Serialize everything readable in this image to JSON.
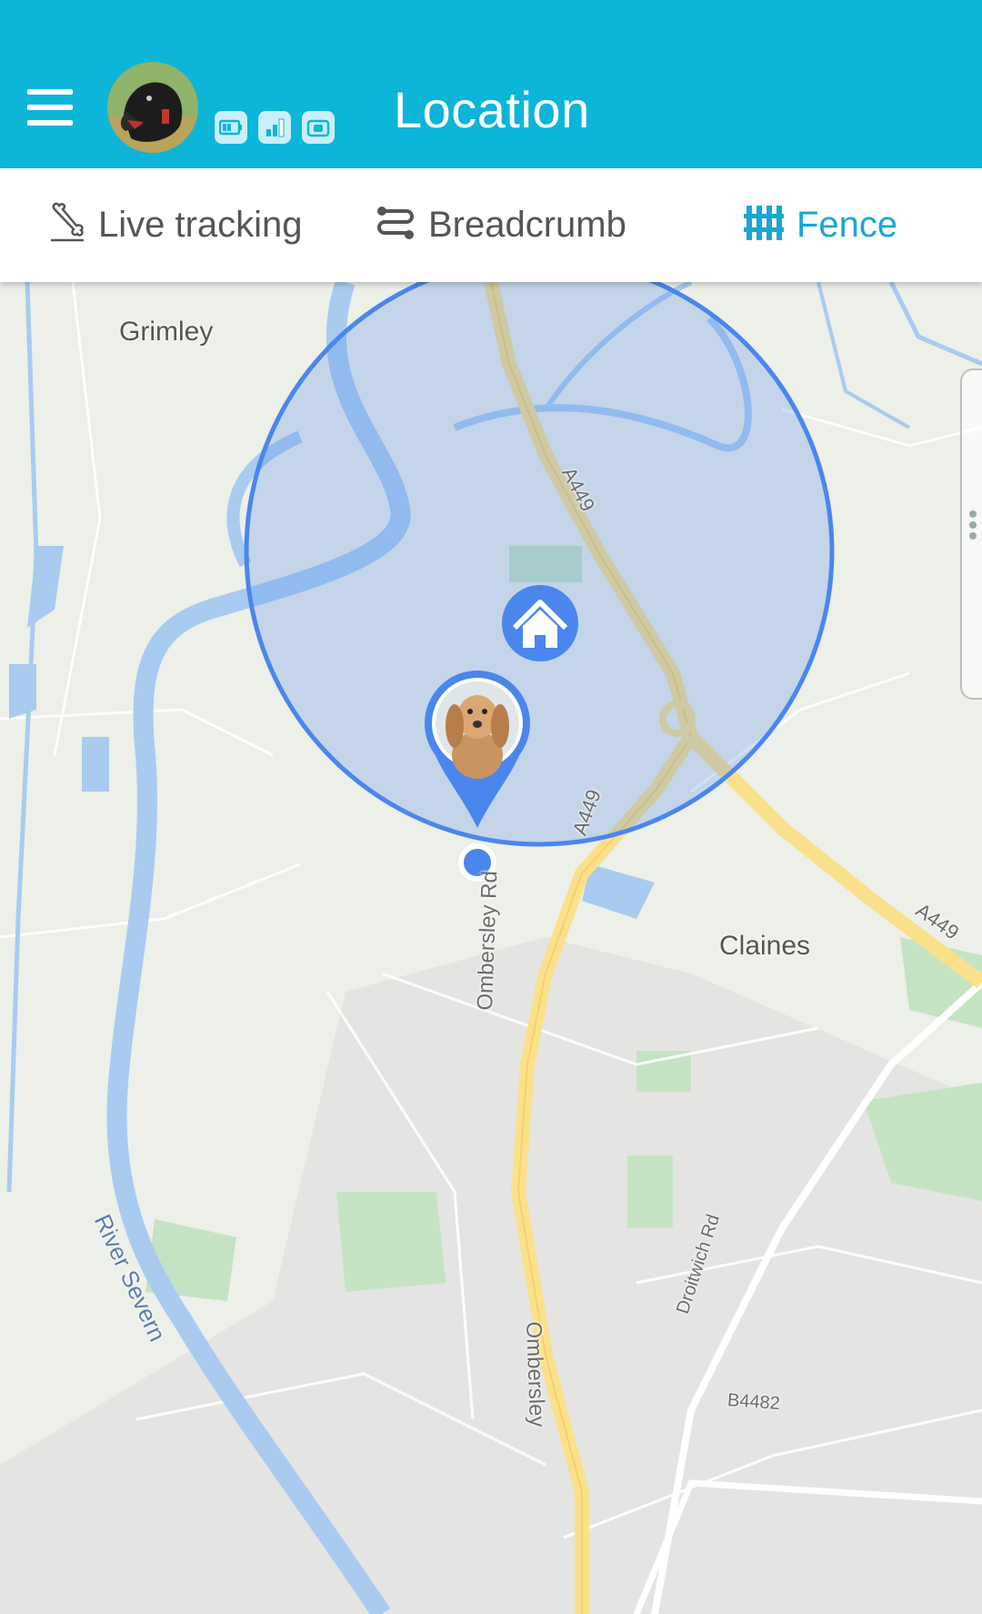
{
  "header": {
    "title": "Location",
    "status_icons": [
      "battery-icon",
      "signal-icon",
      "camera-icon"
    ],
    "accent_color": "#0db5d9"
  },
  "tabs": [
    {
      "label": "Live tracking",
      "icon": "bone-icon",
      "active": false
    },
    {
      "label": "Breadcrumb",
      "icon": "route-icon",
      "active": false
    },
    {
      "label": "Fence",
      "icon": "fence-icon",
      "active": true
    }
  ],
  "map": {
    "places": {
      "grimley": "Grimley",
      "claines": "Claines"
    },
    "roads": {
      "a449_north": "A449",
      "a449_mid": "A449",
      "a449_east": "A449",
      "ombersley_rd_1": "Ombersley Rd",
      "ombersley_rd_2": "Ombersley",
      "droitwich_rd": "Droitwich Rd",
      "b4482": "B4482"
    },
    "river": "River Severn",
    "fence_color": "#4a86ec",
    "markers": [
      "home-icon",
      "pet-avatar"
    ]
  }
}
